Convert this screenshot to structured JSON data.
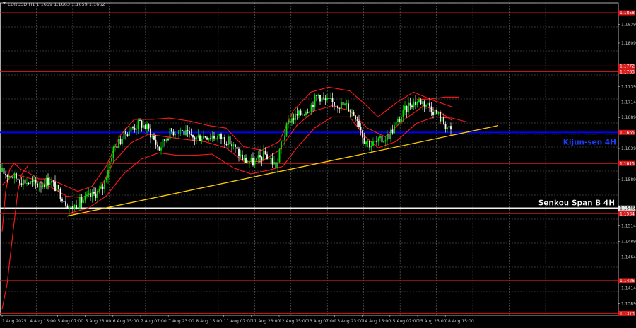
{
  "chart_data": {
    "type": "candlestick",
    "symbol_header": "EURUSD,H1  1.1659 1.1663 1.1659 1.1662",
    "colors": {
      "background": "#000000",
      "grid": "#6b6b6b",
      "bull": "#00e600",
      "bear": "#ffffff",
      "ichimoku": "#ff1a1a",
      "level": "#d81b1b",
      "kijun_line": "#0000ff",
      "senkou_line": "#f0f0f0",
      "trendline": "#ffcc00"
    },
    "ylim": [
      1.137,
      1.1874
    ],
    "y_ticks": [
      "1.1839",
      "1.1809",
      "1.1739",
      "1.1714",
      "1.1689",
      "1.1639",
      "1.1589",
      "1.1539",
      "1.1514",
      "1.1489",
      "1.1464",
      "1.1414",
      "1.1389"
    ],
    "x_ticks": [
      "1 Aug 2025",
      "4 Aug 15:00",
      "5 Aug 07:00",
      "5 Aug 23:00",
      "6 Aug 15:00",
      "7 Aug 07:00",
      "7 Aug 23:00",
      "8 Aug 15:00",
      "11 Aug 07:00",
      "11 Aug 23:00",
      "12 Aug 15:00",
      "13 Aug 07:00",
      "13 Aug 23:00",
      "14 Aug 15:00",
      "15 Aug 07:00",
      "15 Aug 23:00",
      "18 Aug 15:00"
    ],
    "levels": [
      {
        "price": 1.1858,
        "label": "1.1858"
      },
      {
        "price": 1.1772,
        "label": "1.1772"
      },
      {
        "price": 1.1763,
        "label": "1.1763"
      },
      {
        "price": 1.1615,
        "label": "1.1615"
      },
      {
        "price": 1.1534,
        "label": "1.1534"
      },
      {
        "price": 1.1426,
        "label": "1.1426"
      },
      {
        "price": 1.1373,
        "label": "1.1373"
      }
    ],
    "kijun": {
      "price": 1.1665,
      "label": "Kijun-sen 4H",
      "tag": "1.1665"
    },
    "senkou": {
      "price": 1.1543,
      "label": "Senkou Span B 4H",
      "tag": "1.1546"
    },
    "current_price": {
      "price": 1.1662,
      "tag": "1.1662"
    },
    "trendline": {
      "x0": 95,
      "y0": 1.153,
      "x1": 705,
      "y1": 1.1676
    },
    "path_points": [
      [
        3,
        1.1601
      ],
      [
        40,
        1.1584
      ],
      [
        55,
        1.158
      ],
      [
        70,
        1.1589
      ],
      [
        85,
        1.1566
      ],
      [
        100,
        1.1542
      ],
      [
        115,
        1.1554
      ],
      [
        130,
        1.1563
      ],
      [
        145,
        1.1574
      ],
      [
        160,
        1.1638
      ],
      [
        180,
        1.1666
      ],
      [
        198,
        1.168
      ],
      [
        210,
        1.167
      ],
      [
        225,
        1.1638
      ],
      [
        240,
        1.1665
      ],
      [
        255,
        1.167
      ],
      [
        270,
        1.1655
      ],
      [
        290,
        1.166
      ],
      [
        310,
        1.1658
      ],
      [
        325,
        1.165
      ],
      [
        345,
        1.162
      ],
      [
        360,
        1.1616
      ],
      [
        375,
        1.163
      ],
      [
        392,
        1.161
      ],
      [
        398,
        1.1648
      ],
      [
        410,
        1.1686
      ],
      [
        425,
        1.1694
      ],
      [
        440,
        1.1708
      ],
      [
        450,
        1.1726
      ],
      [
        460,
        1.1715
      ],
      [
        475,
        1.1712
      ],
      [
        490,
        1.1708
      ],
      [
        505,
        1.169
      ],
      [
        515,
        1.1655
      ],
      [
        525,
        1.1645
      ],
      [
        540,
        1.1652
      ],
      [
        550,
        1.166
      ],
      [
        565,
        1.1686
      ],
      [
        580,
        1.1712
      ],
      [
        595,
        1.1716
      ],
      [
        608,
        1.1708
      ],
      [
        620,
        1.1693
      ],
      [
        630,
        1.1678
      ],
      [
        640,
        1.1662
      ]
    ],
    "ichimoku_lines": [
      [
        [
          3,
          1.1505
        ],
        [
          8,
          1.157
        ],
        [
          14,
          1.1606
        ],
        [
          20,
          1.1615
        ],
        [
          30,
          1.1605
        ],
        [
          40,
          1.16
        ],
        [
          55,
          1.159
        ],
        [
          70,
          1.159
        ],
        [
          90,
          1.158
        ],
        [
          110,
          1.157
        ],
        [
          130,
          1.1578
        ],
        [
          150,
          1.161
        ],
        [
          170,
          1.166
        ],
        [
          190,
          1.1686
        ],
        [
          215,
          1.1686
        ],
        [
          240,
          1.1688
        ],
        [
          270,
          1.1683
        ],
        [
          295,
          1.1676
        ],
        [
          320,
          1.1672
        ],
        [
          345,
          1.1642
        ],
        [
          370,
          1.1636
        ],
        [
          395,
          1.165
        ],
        [
          415,
          1.17
        ],
        [
          440,
          1.173
        ],
        [
          465,
          1.1738
        ],
        [
          495,
          1.1732
        ],
        [
          515,
          1.1712
        ],
        [
          535,
          1.169
        ],
        [
          560,
          1.1712
        ],
        [
          585,
          1.173
        ],
        [
          610,
          1.1718
        ],
        [
          640,
          1.1706
        ]
      ],
      [
        [
          3,
          1.158
        ],
        [
          20,
          1.1598
        ],
        [
          45,
          1.159
        ],
        [
          70,
          1.1578
        ],
        [
          95,
          1.1562
        ],
        [
          115,
          1.156
        ],
        [
          140,
          1.157
        ],
        [
          160,
          1.1616
        ],
        [
          185,
          1.1648
        ],
        [
          210,
          1.1662
        ],
        [
          235,
          1.1658
        ],
        [
          260,
          1.1654
        ],
        [
          290,
          1.165
        ],
        [
          320,
          1.164
        ],
        [
          345,
          1.1618
        ],
        [
          370,
          1.1618
        ],
        [
          395,
          1.1636
        ],
        [
          420,
          1.1676
        ],
        [
          445,
          1.17
        ],
        [
          470,
          1.1708
        ],
        [
          495,
          1.17
        ],
        [
          520,
          1.1672
        ],
        [
          545,
          1.1658
        ],
        [
          570,
          1.1684
        ],
        [
          600,
          1.1708
        ],
        [
          625,
          1.1696
        ],
        [
          640,
          1.1684
        ]
      ],
      [
        [
          100,
          1.1535
        ],
        [
          125,
          1.1543
        ],
        [
          150,
          1.1562
        ],
        [
          175,
          1.1598
        ],
        [
          200,
          1.1622
        ],
        [
          225,
          1.1632
        ],
        [
          250,
          1.1628
        ],
        [
          275,
          1.1628
        ],
        [
          300,
          1.163
        ],
        [
          330,
          1.1608
        ],
        [
          355,
          1.1598
        ],
        [
          380,
          1.1604
        ],
        [
          400,
          1.161
        ],
        [
          420,
          1.164
        ],
        [
          445,
          1.1672
        ],
        [
          470,
          1.169
        ],
        [
          495,
          1.169
        ],
        [
          515,
          1.166
        ],
        [
          535,
          1.164
        ],
        [
          560,
          1.165
        ],
        [
          590,
          1.168
        ],
        [
          615,
          1.169
        ],
        [
          640,
          1.1688
        ],
        [
          660,
          1.1682
        ]
      ],
      [
        [
          3,
          1.138
        ],
        [
          10,
          1.142
        ],
        [
          15,
          1.147
        ],
        [
          20,
          1.152
        ],
        [
          25,
          1.1568
        ],
        [
          30,
          1.1596
        ],
        [
          40,
          1.1612
        ]
      ],
      [
        [
          590,
          1.1718
        ],
        [
          610,
          1.1719
        ],
        [
          630,
          1.1722
        ],
        [
          650,
          1.1722
        ]
      ]
    ]
  }
}
